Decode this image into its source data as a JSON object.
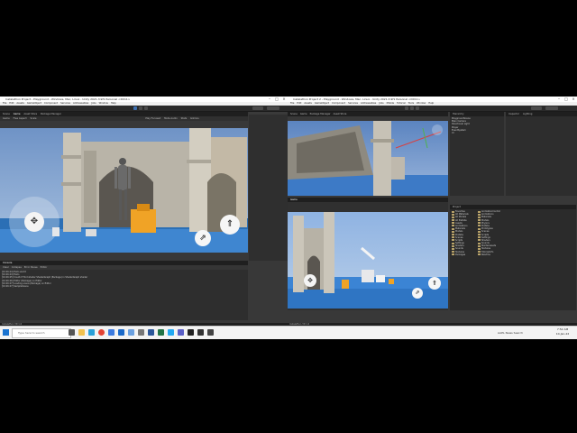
{
  "left_window": {
    "title": "Instalathon Project - Playground - Windows, Mac, Linux - Unity 2021.3.9f1 Personal <DX11>",
    "menu": [
      "File",
      "Edit",
      "Assets",
      "GameObject",
      "Component",
      "Services",
      "Addressables",
      "Jobs",
      "Window",
      "Help"
    ],
    "tabs": {
      "scene": "Scene",
      "game": "Game",
      "asset_store": "Asset Store",
      "package_manager": "Package Manager"
    },
    "game_toolbar": {
      "display": "Game",
      "free_aspect": "Free Aspect",
      "scale": "Scale",
      "play_focused": "Play Focused",
      "mute": "Mute Audio",
      "stats": "Stats",
      "gizmos": "Gizmos"
    },
    "console": {
      "tab": "Console",
      "toolbar": [
        "Clear",
        "Collapse",
        "Error Pause",
        "Editor"
      ],
      "logs": [
        "[10:26:24] Hello world",
        "[10:26:24] Hello",
        "[10:26:25] Couldn't find shader ShaderGraph (Package) in ShaderGraph shader",
        "[10:26:26] Editor (Package) on Editor",
        "[10:26:27] Loading scene (Package) on Editor",
        "[10:26:27] SampleScene"
      ]
    },
    "status": "Instalathon 3D 1.0"
  },
  "right_window": {
    "title": "Instalathon Project 2 - Playground - Windows, Mac, Linux - Unity 2021.3.9f1 Personal <DX11>",
    "menu": [
      "File",
      "Edit",
      "Assets",
      "GameObject",
      "Component",
      "Services",
      "Addressables",
      "Jobs",
      "Mobile",
      "Tutorial",
      "Tools",
      "Window",
      "Help"
    ],
    "tabs_top": [
      "Scene",
      "Game",
      "Package Manager",
      "Asset Store"
    ],
    "hierarchy": {
      "tab": "Hierarchy",
      "items": [
        "PlaygroundScene",
        "Main Camera",
        "Directional Light",
        "Player",
        "EventSystem",
        "UI"
      ]
    },
    "inspector_tab": "Inspector",
    "lighting_tab": "Lighting",
    "project": {
      "tab": "Project",
      "tree": [
        "Favorites",
        "All Materials",
        "All Models",
        "All Prefabs",
        "Assets",
        "Animations",
        "Materials",
        "Models",
        "Prefabs",
        "Scenes",
        "Scripts",
        "Settings",
        "Shaders",
        "Sounds",
        "Textures",
        "Packages"
      ],
      "assets": [
        "AnimationControl",
        "Animations",
        "Materials",
        "Models",
        "Physics",
        "Prefabs",
        "Prototypes",
        "Scenes",
        "Scripts",
        "Settings",
        "Shaders",
        "Sounds",
        "StarterAssets",
        "Textures",
        "TutorialInfo",
        "Readme"
      ]
    },
    "game_label": "Game",
    "status": "Instalathon 3D 1.0"
  },
  "taskbar": {
    "search_placeholder": "Type here to search",
    "weather": "AAPL News Search",
    "time": "7:52 AM",
    "date": "10-Jan-22"
  }
}
